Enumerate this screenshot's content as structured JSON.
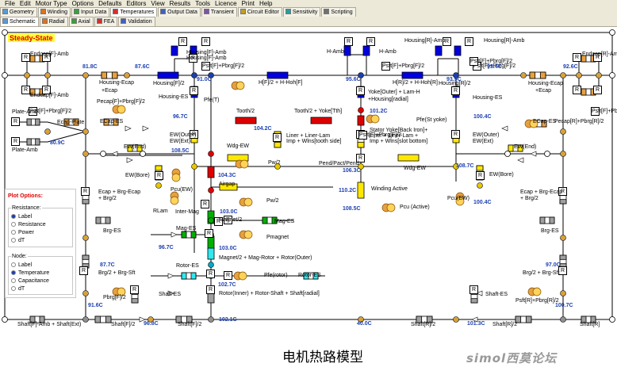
{
  "menu": [
    "File",
    "Edit",
    "Motor Type",
    "Options",
    "Defaults",
    "Editors",
    "View",
    "Results",
    "Tools",
    "Licence",
    "Print",
    "Help"
  ],
  "tabs1": [
    "Geometry",
    "Winding",
    "Input Data",
    "Temperatures",
    "Output Data",
    "Transient",
    "Circuit Editor",
    "Sensitivity",
    "Scripting"
  ],
  "tabs2": [
    "Schematic",
    "Radial",
    "Axial",
    "FEA",
    "Validation"
  ],
  "title": "Steady-State",
  "plot_options": {
    "title": "Plot Options:",
    "resistance": {
      "title": "Resistance:",
      "options": [
        "Label",
        "Resistance",
        "Power",
        "dT"
      ],
      "selected": "Label"
    },
    "node": {
      "title": "Node:",
      "options": [
        "Label",
        "Temperature",
        "Capacitance",
        "dT"
      ],
      "selected": "Temperature"
    }
  },
  "temps": [
    "81.8C",
    "87.6C",
    "91.0C",
    "95.6C",
    "93.9C",
    "93.4C",
    "92.6C",
    "80.9C",
    "96.7C",
    "104.2C",
    "101.2C",
    "100.4C",
    "108.5C",
    "108.7C",
    "104.3C",
    "106.3C",
    "110.2C",
    "108.5C",
    "100.4C",
    "103.0C",
    "96.7C",
    "103.0C",
    "102.7C",
    "87.7C",
    "97.0C",
    "91.6C",
    "96.8C",
    "102.1C",
    "40.0C",
    "101.3C",
    "100.7C"
  ],
  "labels": [
    "Endcap[F]-Amb",
    "Endcap[F]-Amb",
    "Housing[F]-Amb",
    "Housing[F]-Amb",
    "H-Amb",
    "H-Amb",
    "Housing[R]-Amb",
    "Housing[R]-Amb",
    "Endcap[R]-Amb",
    "Housing-Ecap",
    "+Ecap",
    "Housing[F]/2",
    "H[F]/2 + H-Hoh[F]",
    "H[R]/2 + H-Hoh[R]",
    "Housing[R]/2",
    "Housing-Ecap",
    "+Ecap",
    "Pecap[F]+Pbrg[F]/2",
    "Housing-ES",
    "Pfe(T)",
    "Yoke[Outer] + Lam-H",
    "+Housing[radial]",
    "Housing-ES",
    "Plate-Amb",
    "Plate-Amb",
    "Ecap-Plate",
    "ECap-ES",
    "Tooth/2",
    "Tooth/2 + Yoke[Tth]",
    "Pfe(St yoke)",
    "ECap-ES",
    "Pecap[R]+Pbrg[R]/2",
    "Liner + Liner-Lam",
    "Imp + Wlns[tooth side]",
    "Stator Yoke[Back Iron]+",
    "Liner + Liner-Lam +",
    "Imp + Wlns[slot bottom]",
    "EW(Outer)",
    "EW(Ext)",
    "EW(Outer)",
    "EW(Ext)",
    "EW(End)",
    "Wdg-EW",
    "Pend/Pact/Pend",
    "Wdg-EW",
    "EW(End)",
    "EW(Bore)",
    "Pw/2",
    "EW(Bore)",
    "Airgap",
    "Winding Active",
    "Pcu(EW)",
    "Pcu(EW)",
    "Pw/2",
    "Ecap + Brg-Ecap",
    "+ Brg/2",
    "Ecap + Brg-Ecap",
    "+ Brg/2",
    "RLam",
    "Inter-Mag",
    "Pcu (Active)",
    "Magnet/2",
    "Mag-ES",
    "Brg-ES",
    "Brg-ES",
    "Mag-ES",
    "Pmagnet",
    "Magnet/2 + Mag-Rotor + Rotor(Outer)",
    "Rotor-ES",
    "Rotor-ES",
    "Pfe(rotor)",
    "Brg/2 + Brg-Sft",
    "Brg/2 + Brg-Sft",
    "Pbrg[F]/2",
    "Shaft-ES",
    "Shaft-ES",
    "Psft[R]+Pbrg[R]/2",
    "Rotor(Inner) + Rotor-Shaft + Shaft[radial]",
    "Shaft[F]-Amb + Shaft(Ext)",
    "Shaft[F]/2",
    "Shaft[F]/2",
    "Shaft[R]/2",
    "Shaft[R]/2",
    "Shaft[R]",
    "C",
    "R",
    "Psft[F]+Pbrg[F]/2"
  ],
  "caption": "电机热路模型",
  "watermark": "simol西莫论坛",
  "colors": {
    "temp_text": "#1c3fb0",
    "title_red": "#e00000",
    "resistor_blue": "#0000e0",
    "resistor_red": "#e00000",
    "resistor_orange": "#e8a040",
    "resistor_yellow": "#ffe800",
    "resistor_green": "#00b000",
    "resistor_cyan": "#30e8f0",
    "resistor_gray": "#a0a0a0"
  }
}
